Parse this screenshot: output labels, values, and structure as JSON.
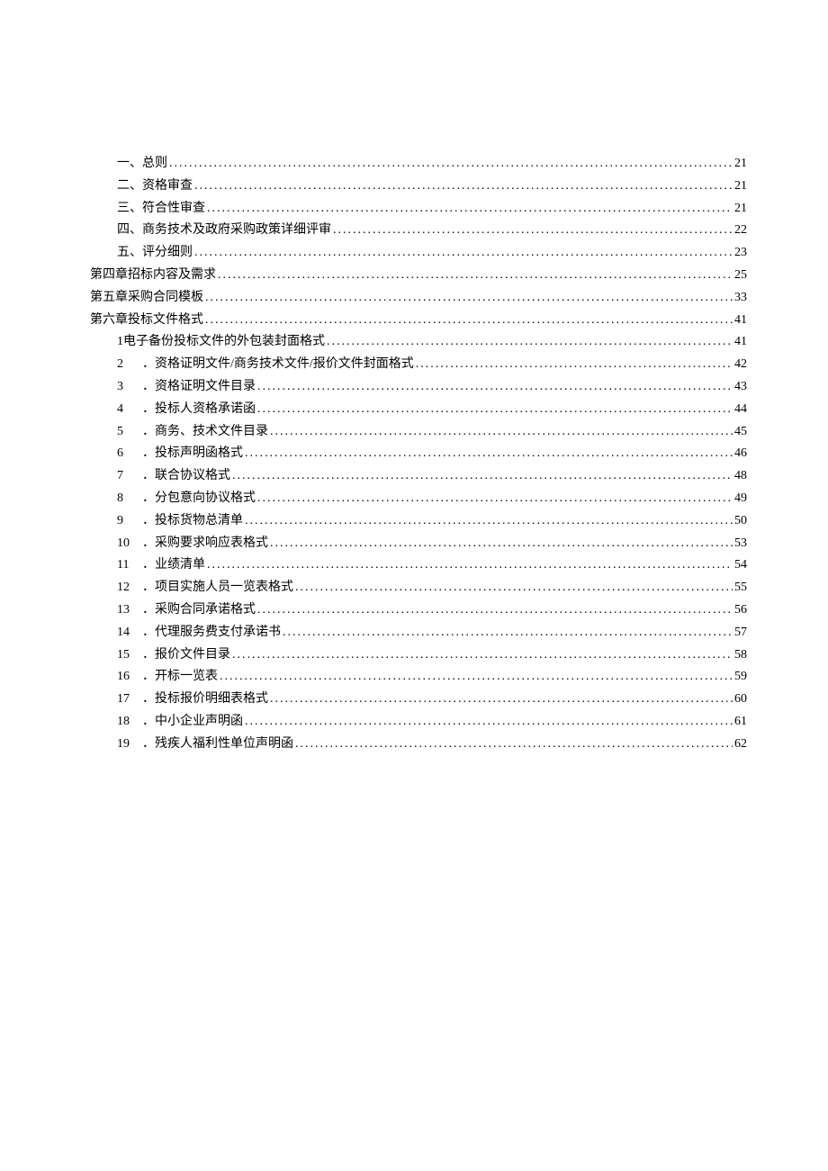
{
  "toc": [
    {
      "level": 1,
      "num": "一、",
      "title": "总则",
      "page": "21",
      "numClass": ""
    },
    {
      "level": 1,
      "num": "二、",
      "title": "资格审查",
      "page": "21",
      "numClass": ""
    },
    {
      "level": 1,
      "num": "三、",
      "title": "符合性审查",
      "page": "21",
      "numClass": ""
    },
    {
      "level": 1,
      "num": "四、",
      "title": "商务技术及政府采购政策详细评审",
      "page": "22",
      "numClass": ""
    },
    {
      "level": 1,
      "num": "五、",
      "title": "评分细则",
      "page": "23",
      "numClass": ""
    },
    {
      "level": 0,
      "num": "",
      "title": "第四章招标内容及需求",
      "page": "25",
      "numClass": ""
    },
    {
      "level": 0,
      "num": "",
      "title": "第五章采购合同模板",
      "page": "33",
      "numClass": ""
    },
    {
      "level": 0,
      "num": "",
      "title": "第六章投标文件格式",
      "page": "41",
      "numClass": ""
    },
    {
      "level": 2,
      "num": "1",
      "title": "电子备份投标文件的外包装封面格式 ",
      "page": "41",
      "numClass": "",
      "sep": " "
    },
    {
      "level": 2,
      "num": "2",
      "title": "资格证明文件/商务技术文件/报价文件封面格式",
      "page": "42",
      "numClass": "wide",
      "sep": "．"
    },
    {
      "level": 2,
      "num": "3",
      "title": "资格证明文件目录",
      "page": "43",
      "numClass": "wide",
      "sep": "．"
    },
    {
      "level": 2,
      "num": "4",
      "title": "投标人资格承诺函",
      "page": "44",
      "numClass": "wide",
      "sep": "．"
    },
    {
      "level": 2,
      "num": "5",
      "title": "商务、技术文件目录",
      "page": "45",
      "numClass": "wide",
      "sep": "．"
    },
    {
      "level": 2,
      "num": "6",
      "title": "投标声明函格式",
      "page": "46",
      "numClass": "wide",
      "sep": "．"
    },
    {
      "level": 2,
      "num": "7",
      "title": "联合协议格式",
      "page": "48",
      "numClass": "wide",
      "sep": "．"
    },
    {
      "level": 2,
      "num": "8",
      "title": "分包意向协议格式",
      "page": "49",
      "numClass": "wide",
      "sep": "．"
    },
    {
      "level": 2,
      "num": "9",
      "title": "投标货物总清单",
      "page": "50",
      "numClass": "wide",
      "sep": "．"
    },
    {
      "level": 2,
      "num": "10",
      "title": "采购要求响应表格式",
      "page": "53",
      "numClass": "wide",
      "sep": "．"
    },
    {
      "level": 2,
      "num": "11",
      "title": "业绩清单 ",
      "page": "54",
      "numClass": "wide",
      "sep": "．"
    },
    {
      "level": 2,
      "num": "12",
      "title": "项目实施人员一览表格式",
      "page": "55",
      "numClass": "wide",
      "sep": "．"
    },
    {
      "level": 2,
      "num": "13",
      "title": "采购合同承诺格式",
      "page": "56",
      "numClass": "wide",
      "sep": "．"
    },
    {
      "level": 2,
      "num": "14",
      "title": "代理服务费支付承诺书",
      "page": "57",
      "numClass": "wide",
      "sep": "．"
    },
    {
      "level": 2,
      "num": "15",
      "title": "报价文件目录",
      "page": "58",
      "numClass": "wide",
      "sep": "．"
    },
    {
      "level": 2,
      "num": "16",
      "title": "开标一览表 ",
      "page": "59",
      "numClass": "wide",
      "sep": "．"
    },
    {
      "level": 2,
      "num": "17",
      "title": "投标报价明细表格式",
      "page": "60",
      "numClass": "wide",
      "sep": "．"
    },
    {
      "level": 2,
      "num": "18",
      "title": "中小企业声明函 ",
      "page": "61",
      "numClass": "wide",
      "sep": "．"
    },
    {
      "level": 2,
      "num": "19",
      "title": "残疾人福利性单位声明函 ",
      "page": "62",
      "numClass": "wide",
      "sep": "．"
    }
  ]
}
